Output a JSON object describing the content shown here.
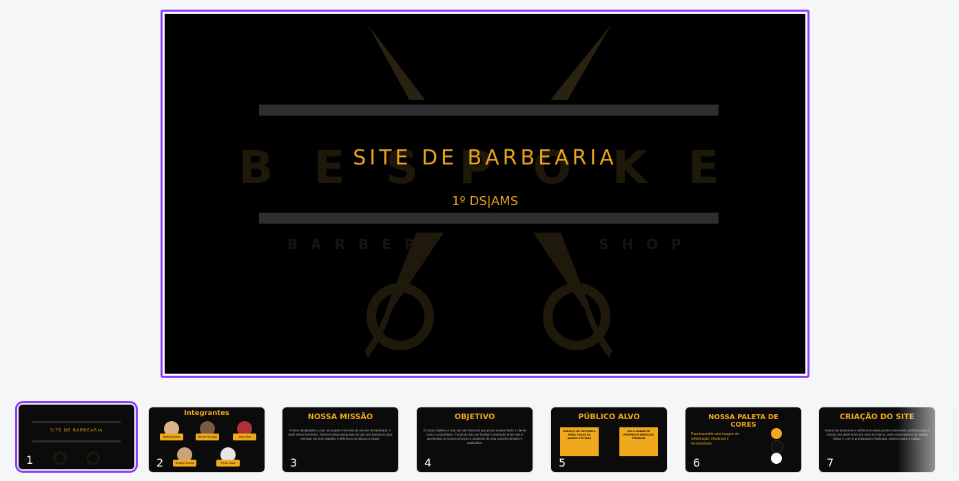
{
  "main_slide": {
    "title": "SITE DE BARBEARIA",
    "subtitle": "1º DS|AMS",
    "logo_word": "B E S P O K E",
    "logo_barber": "B A R B E R",
    "logo_shop": "S H O P"
  },
  "colors": {
    "accent": "#8b3dff",
    "slide_bg": "#000000",
    "gold": "#e8a21a"
  },
  "thumbnails": [
    {
      "number": "1",
      "title": "SITE DE BARBEARIA",
      "selected": true
    },
    {
      "number": "2",
      "title": "Integrantes",
      "members": [
        "Milena Nunes",
        "Renan Rocaghi",
        "Julia Silva",
        "Rodrigo Rocha",
        "Pedro Tavia"
      ]
    },
    {
      "number": "3",
      "title": "NOSSA MISSÃO",
      "body": "Fomos designados a criar um projeto front-end de um site de barbearia. A partir desse momento, fizemos várias pesquisas do que precisaríamos para entregar um bom trabalho e definimos os tópicos a seguir."
    },
    {
      "number": "4",
      "title": "OBJETIVO",
      "body": "O nosso objetivo é criar um site funcional que possa auxiliar tanto o cliente como o proprietário. Focamos isso por facilitar a interação entre eles e apresentar os nossos serviços e ambiente de uma maneira simples e explicativa."
    },
    {
      "number": "5",
      "title": "PÚBLICO ALVO",
      "box1": "SERVIÇO DE DESTREZA PARA TODAS AS IDADES E ETNIAS",
      "box2": "PELO AMBIENTE PRÓPRIO E SERVIÇOS PREMIUM"
    },
    {
      "number": "6",
      "title": "NOSSA PALETA DE CORES",
      "body": "Para transmitir uma imagem de sofisticação, elegância e exclusividade."
    },
    {
      "number": "7",
      "title": "CRIAÇÃO DO SITE",
      "body": "Depois de lançarmos e definirmos esses pontos essenciais, partimos para a criação dos wireframes por meio do Figma, onde expressamos as nossas ideias e, com a protótipagem finalizada, partimos para o código."
    }
  ]
}
